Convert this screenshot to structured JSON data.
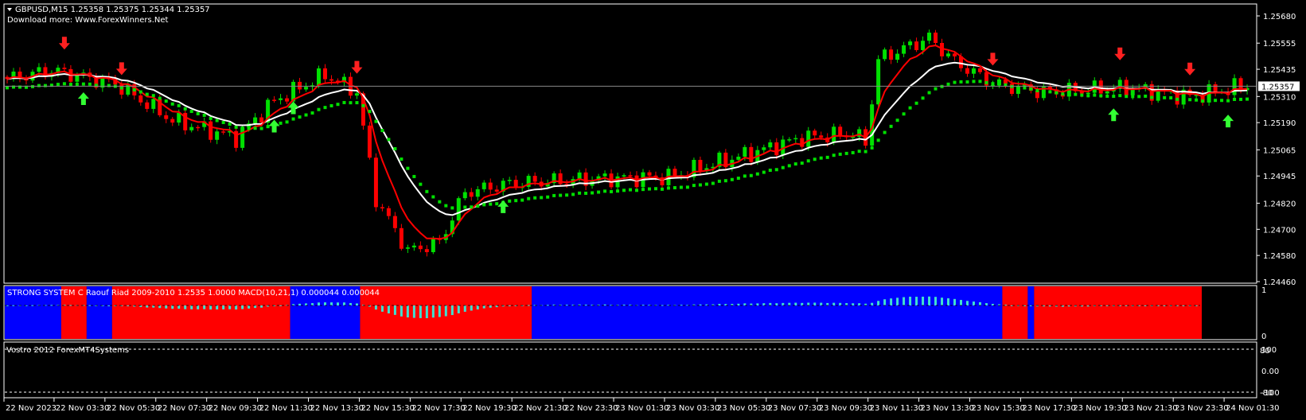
{
  "header": {
    "symbol_line": "GBPUSD,M15  1.25358 1.25375 1.25344 1.25357",
    "subtitle": "Download more: Www.ForexWinners.Net"
  },
  "indicator1": {
    "label": "STRONG SYSTEM C Raouf Riad 2009-2010  1.2535 1.0000  MACD(10,21,1) 0.000044 0.000044",
    "scale_top": "1",
    "scale_bottom": "0"
  },
  "indicator2": {
    "label": "Vostro 2012 ForexMT4Systems",
    "scale_labels": [
      "100",
      "80",
      "0.00",
      "-80",
      "-100"
    ]
  },
  "colors": {
    "bull": "#00e000",
    "bear": "#ff0000",
    "fast_ma": "#ff0000",
    "slow_ma": "#ffffff",
    "signal_dots": "#00e000",
    "pane_blue": "#0000ff",
    "pane_red": "#ff0000",
    "histogram": "#40e0d0"
  },
  "chart_data": {
    "type": "candlestick",
    "symbol": "GBPUSD",
    "timeframe": "M15",
    "ylim": [
      1.2442,
      1.2572
    ],
    "y_ticks": [
      "1.25680",
      "1.25555",
      "1.25435",
      "1.25310",
      "1.25190",
      "1.25065",
      "1.24945",
      "1.24820",
      "1.24700",
      "1.24580",
      "1.24460"
    ],
    "current_price": "1.25357",
    "candle_count": 196,
    "close_path": [
      [
        0,
        1.2539
      ],
      [
        7,
        1.2543
      ],
      [
        17,
        1.2537
      ],
      [
        26,
        1.252
      ],
      [
        36,
        1.2512
      ],
      [
        42,
        1.2529
      ],
      [
        50,
        1.2541
      ],
      [
        55,
        1.2533
      ],
      [
        58,
        1.2484
      ],
      [
        63,
        1.246
      ],
      [
        68,
        1.2464
      ],
      [
        72,
        1.2487
      ],
      [
        79,
        1.2491
      ],
      [
        91,
        1.2493
      ],
      [
        104,
        1.2494
      ],
      [
        117,
        1.2505
      ],
      [
        125,
        1.2512
      ],
      [
        133,
        1.2514
      ],
      [
        135,
        1.251
      ],
      [
        137,
        1.2548
      ],
      [
        145,
        1.2558
      ],
      [
        149,
        1.2547
      ],
      [
        155,
        1.2537
      ],
      [
        163,
        1.2533
      ],
      [
        176,
        1.2535
      ],
      [
        186,
        1.2531
      ],
      [
        195,
        1.2536
      ]
    ],
    "buy_arrows": [
      12,
      42,
      45,
      78,
      174,
      192
    ],
    "sell_arrows": [
      9,
      18,
      55,
      155,
      175,
      186
    ],
    "pane_segments": [
      [
        0,
        9,
        "blue"
      ],
      [
        9,
        13,
        "red"
      ],
      [
        13,
        17,
        "blue"
      ],
      [
        17,
        45,
        "red"
      ],
      [
        45,
        56,
        "blue"
      ],
      [
        56,
        83,
        "red"
      ],
      [
        83,
        157,
        "blue"
      ],
      [
        157,
        161,
        "red"
      ],
      [
        161,
        162,
        "blue"
      ],
      [
        162,
        196,
        "red"
      ]
    ],
    "x_labels": [
      "22 Nov 2023",
      "22 Nov 03:30",
      "22 Nov 05:30",
      "22 Nov 07:30",
      "22 Nov 09:30",
      "22 Nov 11:30",
      "22 Nov 13:30",
      "22 Nov 15:30",
      "22 Nov 17:30",
      "22 Nov 19:30",
      "22 Nov 21:30",
      "22 Nov 23:30",
      "23 Nov 01:30",
      "23 Nov 03:30",
      "23 Nov 05:30",
      "23 Nov 07:30",
      "23 Nov 09:30",
      "23 Nov 11:30",
      "23 Nov 13:30",
      "23 Nov 15:30",
      "23 Nov 17:30",
      "23 Nov 19:30",
      "23 Nov 21:30",
      "23 Nov 23:30",
      "24 Nov 01:30"
    ]
  }
}
